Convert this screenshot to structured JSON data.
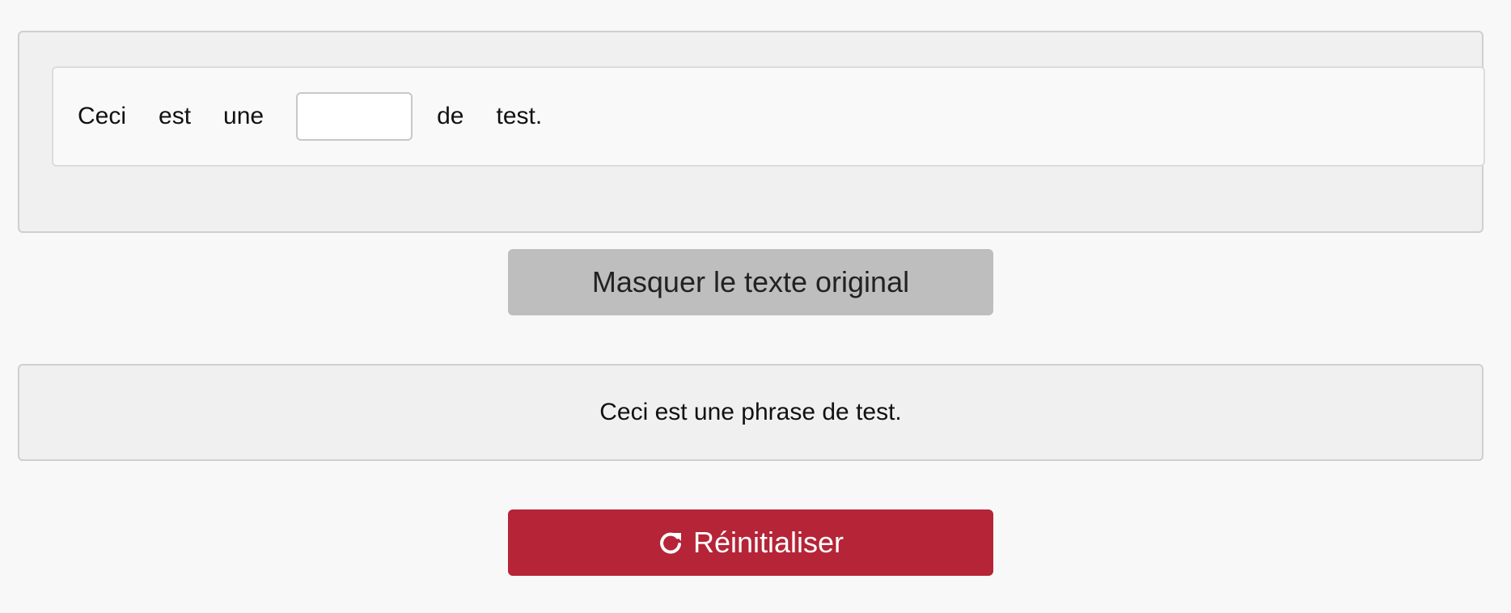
{
  "exercise": {
    "words_before": [
      "Ceci",
      "est",
      "une"
    ],
    "blank_value": "",
    "words_after": [
      "de",
      "test."
    ]
  },
  "toggle_button": {
    "label": "Masquer le texte original"
  },
  "original": {
    "text": "Ceci est une phrase de test."
  },
  "reset_button": {
    "label": "Réinitialiser",
    "icon": "redo-icon",
    "color": "#b52437"
  }
}
